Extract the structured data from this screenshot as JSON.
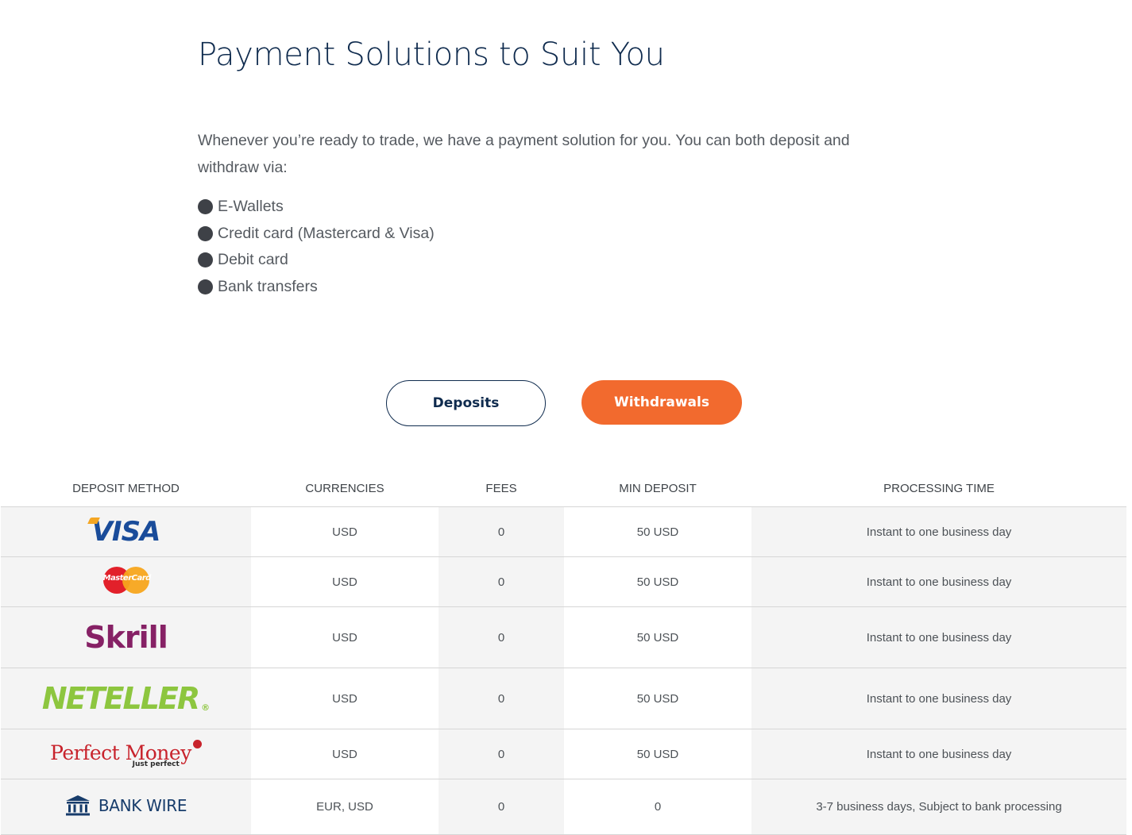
{
  "page": {
    "title": "Payment Solutions to Suit You",
    "intro": "Whenever you’re ready to trade, we have a payment solution for you. You can both deposit and withdraw via:",
    "methods": [
      "E-Wallets",
      "Credit card (Mastercard & Visa)",
      "Debit card",
      "Bank transfers"
    ]
  },
  "tabs": {
    "deposits_label": "Deposits",
    "withdrawals_label": "Withdrawals"
  },
  "colors": {
    "accent": "#f26a2e",
    "navy": "#0f2b4e"
  },
  "table": {
    "headers": [
      "DEPOSIT METHOD",
      "CURRENCIES",
      "FEES",
      "MIN DEPOSIT",
      "PROCESSING TIME"
    ],
    "rows": [
      {
        "method": "VISA",
        "currencies": "USD",
        "fees": "0",
        "min_deposit": "50 USD",
        "processing_time": "Instant to one business day"
      },
      {
        "method": "MasterCard",
        "currencies": "USD",
        "fees": "0",
        "min_deposit": "50 USD",
        "processing_time": "Instant to one business day"
      },
      {
        "method": "Skrill",
        "currencies": "USD",
        "fees": "0",
        "min_deposit": "50 USD",
        "processing_time": "Instant to one business day"
      },
      {
        "method": "NETELLER",
        "method_mark": "®",
        "currencies": "USD",
        "fees": "0",
        "min_deposit": "50 USD",
        "processing_time": "Instant to one business day"
      },
      {
        "method": "Perfect Money",
        "method_sub": "Just perfect",
        "currencies": "USD",
        "fees": "0",
        "min_deposit": "50 USD",
        "processing_time": "Instant to one business day"
      },
      {
        "method": "BANK WIRE",
        "method_icon": "bank-building-icon",
        "currencies": "EUR, USD",
        "fees": "0",
        "min_deposit": "0",
        "processing_time": "3-7 business days, Subject to bank processing"
      }
    ]
  }
}
